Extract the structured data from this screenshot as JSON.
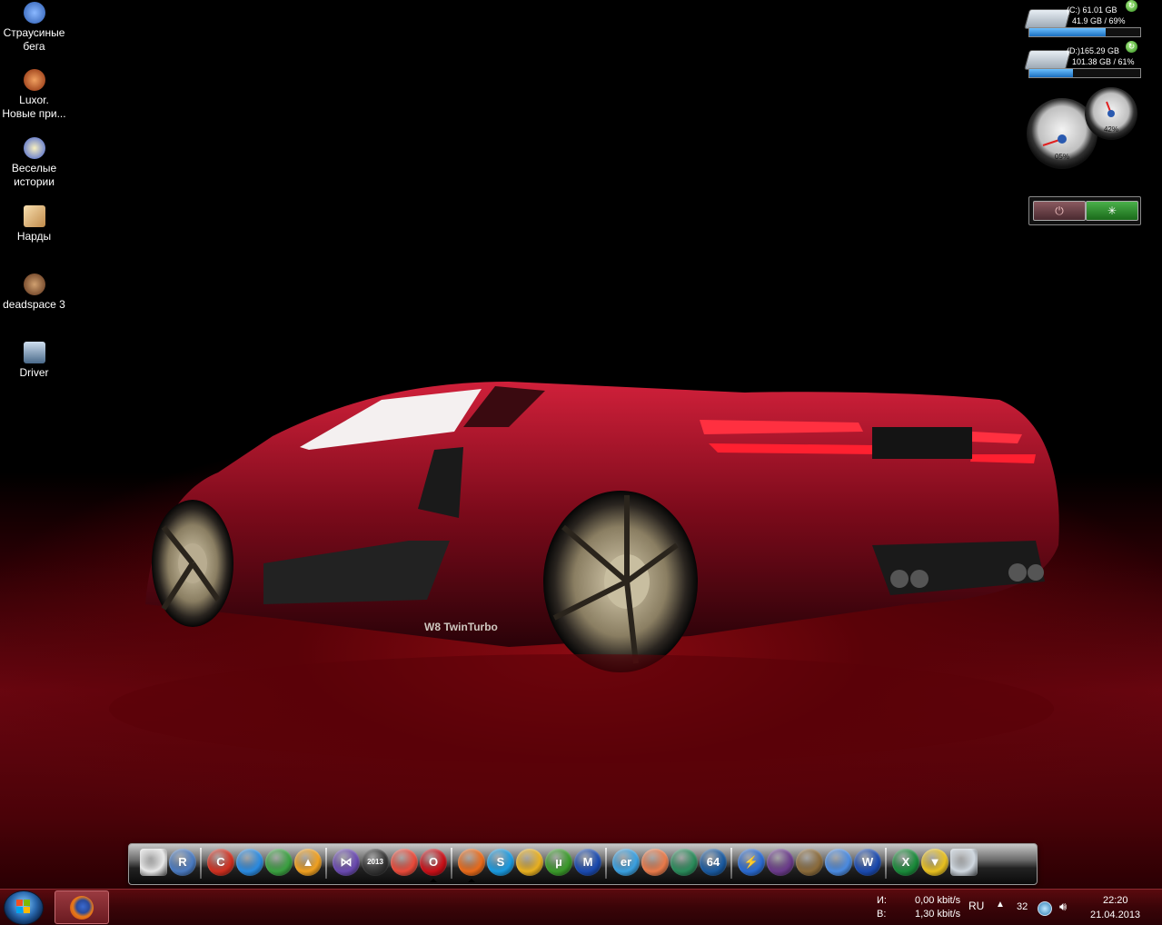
{
  "desktop_icons": [
    {
      "line1": "Страусиные",
      "line2": "бега",
      "icon": "ostrich-race-icon",
      "color": "#3a6fd0"
    },
    {
      "line1": "Luxor.",
      "line2": "Новые при...",
      "icon": "luxor-icon",
      "color": "#c0561a"
    },
    {
      "line1": "Веселые",
      "line2": "истории",
      "icon": "funny-stories-icon",
      "color": "#4a7ad8"
    },
    {
      "line1": "Нарды",
      "line2": "",
      "icon": "backgammon-icon",
      "color": "#e8c08a"
    },
    {
      "line1": "deadspace 3",
      "line2": "",
      "icon": "deadspace-icon",
      "color": "#8a5a3a"
    },
    {
      "line1": "Driver",
      "line2": "",
      "icon": "driver-icon",
      "color": "#6a8aa8"
    }
  ],
  "drives": [
    {
      "name": "(C:) 61.01 GB",
      "used": "41.9 GB / 69%",
      "fill_fraction": 0.69
    },
    {
      "name": "(D:)165.29 GB",
      "used": "101.38 GB / 61%",
      "fill_fraction": 0.39
    }
  ],
  "gauges": {
    "cpu": "05%",
    "ram": "42%"
  },
  "power_gadget": {
    "power_symbol": "⏻",
    "restart_symbol": "✳"
  },
  "dock": {
    "items": [
      {
        "name": "presentation-icon",
        "label": "",
        "color": "#e8e8e8"
      },
      {
        "name": "reader-icon",
        "label": "R",
        "color": "#4a7ac0"
      },
      {
        "name": "ccleaner-icon",
        "label": "C",
        "color": "#d03020"
      },
      {
        "name": "globe-icon",
        "label": "",
        "color": "#2a8ae0"
      },
      {
        "name": "tools-icon",
        "label": "",
        "color": "#3aa040"
      },
      {
        "name": "aimp-icon",
        "label": "▲",
        "color": "#f0a020"
      },
      {
        "name": "media-player-icon",
        "label": "⋈",
        "color": "#6a4ab0"
      },
      {
        "name": "nero-icon",
        "label": "2013",
        "color": "#333"
      },
      {
        "name": "picasa-icon",
        "label": "",
        "color": "#e84a3a"
      },
      {
        "name": "opera-icon",
        "label": "O",
        "color": "#c81018"
      },
      {
        "name": "firefox-icon",
        "label": "",
        "color": "#e86a1a"
      },
      {
        "name": "skype-icon",
        "label": "S",
        "color": "#1a9ae0"
      },
      {
        "name": "webcam-icon",
        "label": "",
        "color": "#e8b020"
      },
      {
        "name": "utorrent-icon",
        "label": "µ",
        "color": "#3a9a2a"
      },
      {
        "name": "malwarebytes-icon",
        "label": "M",
        "color": "#1a4ab0"
      },
      {
        "name": "everest-icon",
        "label": "er",
        "color": "#3aa0e0"
      },
      {
        "name": "email-icon",
        "label": "",
        "color": "#e87a4a"
      },
      {
        "name": "door-icon",
        "label": "",
        "color": "#2a8a5a"
      },
      {
        "name": "aida64-icon",
        "label": "64",
        "color": "#1a5aa0"
      },
      {
        "name": "daemon-tools-icon",
        "label": "⚡",
        "color": "#2a6ad0"
      },
      {
        "name": "dvd-icon",
        "label": "",
        "color": "#6a3a8a"
      },
      {
        "name": "pencil-icon",
        "label": "",
        "color": "#8a6a3a"
      },
      {
        "name": "network-icon",
        "label": "",
        "color": "#4a8ae0"
      },
      {
        "name": "word-icon",
        "label": "W",
        "color": "#1a4ab0"
      },
      {
        "name": "excel-icon",
        "label": "X",
        "color": "#1a8a3a"
      },
      {
        "name": "triangle-app-icon",
        "label": "▼",
        "color": "#e8c020"
      },
      {
        "name": "recycle-bin-icon",
        "label": "",
        "color": "#d0d8e0"
      }
    ]
  },
  "taskbar": {
    "network_in_label": "И:",
    "network_out_label": "В:",
    "network_in": "0,00 kbit/s",
    "network_out": "1,30 kbit/s",
    "language": "RU",
    "tray_number": "32",
    "time": "22:20",
    "date": "21.04.2013"
  },
  "wallpaper": {
    "badge_text": "W8 TwinTurbo"
  }
}
